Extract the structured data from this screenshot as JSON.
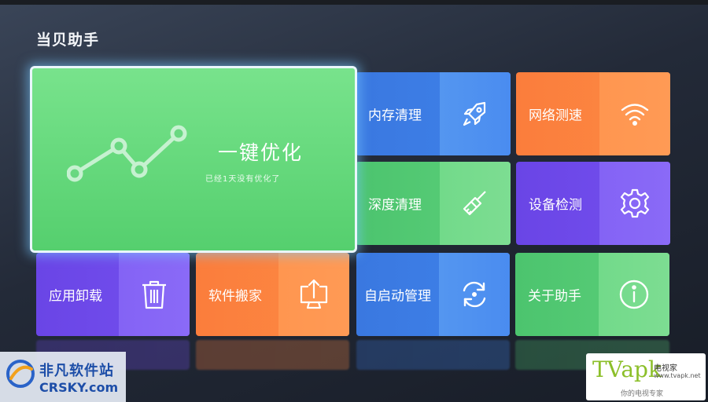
{
  "app": {
    "title": "当贝助手"
  },
  "featured": {
    "title": "一键优化",
    "subtitle": "已经1天没有优化了",
    "icon": "trend-line-icon"
  },
  "tiles": [
    {
      "label": "内存清理",
      "icon": "rocket-icon",
      "color": "blue"
    },
    {
      "label": "网络测速",
      "icon": "wifi-icon",
      "color": "orange"
    },
    {
      "label": "深度清理",
      "icon": "broom-icon",
      "color": "green"
    },
    {
      "label": "设备检测",
      "icon": "gear-icon",
      "color": "purple"
    },
    {
      "label": "应用卸载",
      "icon": "trash-icon",
      "color": "purple"
    },
    {
      "label": "软件搬家",
      "icon": "export-icon",
      "color": "orange"
    },
    {
      "label": "自启动管理",
      "icon": "refresh-icon",
      "color": "blue"
    },
    {
      "label": "关于助手",
      "icon": "info-icon",
      "color": "green"
    }
  ],
  "watermarks": {
    "left": {
      "line1": "非凡软件站",
      "line2": "CRSKY.com"
    },
    "right": {
      "logo": "TVapk",
      "name": "电视家",
      "url": "www.tvapk.net",
      "slogan": "你的电视专家"
    }
  },
  "colors": {
    "blue": "#3f82ea",
    "orange": "#fc8a43",
    "green": "#5ccf7a",
    "purple": "#7450ee"
  }
}
